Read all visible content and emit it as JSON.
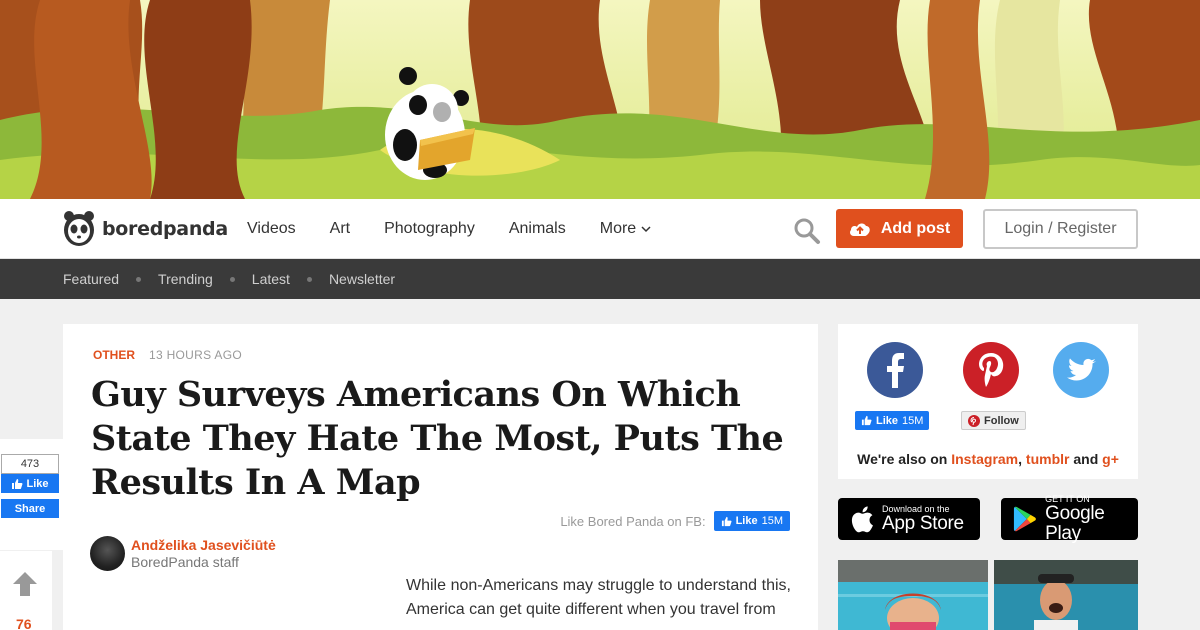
{
  "nav": {
    "logo_text": "boredpanda",
    "items": [
      {
        "label": "Videos"
      },
      {
        "label": "Art"
      },
      {
        "label": "Photography"
      },
      {
        "label": "Animals"
      }
    ],
    "more_label": "More",
    "add_post_label": "Add post",
    "login_label": "Login / Register"
  },
  "subnav": {
    "items": [
      {
        "label": "Featured"
      },
      {
        "label": "Trending"
      },
      {
        "label": "Latest"
      },
      {
        "label": "Newsletter"
      }
    ]
  },
  "article": {
    "category": "OTHER",
    "time": "13 HOURS AGO",
    "title": "Guy Surveys Americans On Which State They Hate The Most, Puts The Results In A Map",
    "fb_prompt": "Like Bored Panda on FB:",
    "fb_like_label": "Like",
    "fb_like_count": "15M",
    "author_name": "Andželika Jasevičiūtė",
    "author_role": "BoredPanda staff",
    "body": "While non-Americans may struggle to understand this, America can get quite different when you travel from"
  },
  "share_widget": {
    "count": "473",
    "like_label": "Like",
    "share_label": "Share",
    "votes": "76"
  },
  "sidebar": {
    "fb_like_label": "Like",
    "fb_like_count": "15M",
    "pin_follow_label": "Follow",
    "also_prefix": "We're also on",
    "also_links": [
      "Instagram",
      "tumblr",
      "g+"
    ],
    "also_sep_comma": ",",
    "also_and": "and",
    "app_store_small": "Download on the",
    "app_store_big": "App Store",
    "google_small": "GET IT ON",
    "google_big": "Google Play"
  },
  "colors": {
    "accent": "#e0501e",
    "facebook": "#3b5998",
    "pinterest": "#cb2027",
    "twitter": "#55acee",
    "subnav_bg": "#3a3a3a"
  }
}
